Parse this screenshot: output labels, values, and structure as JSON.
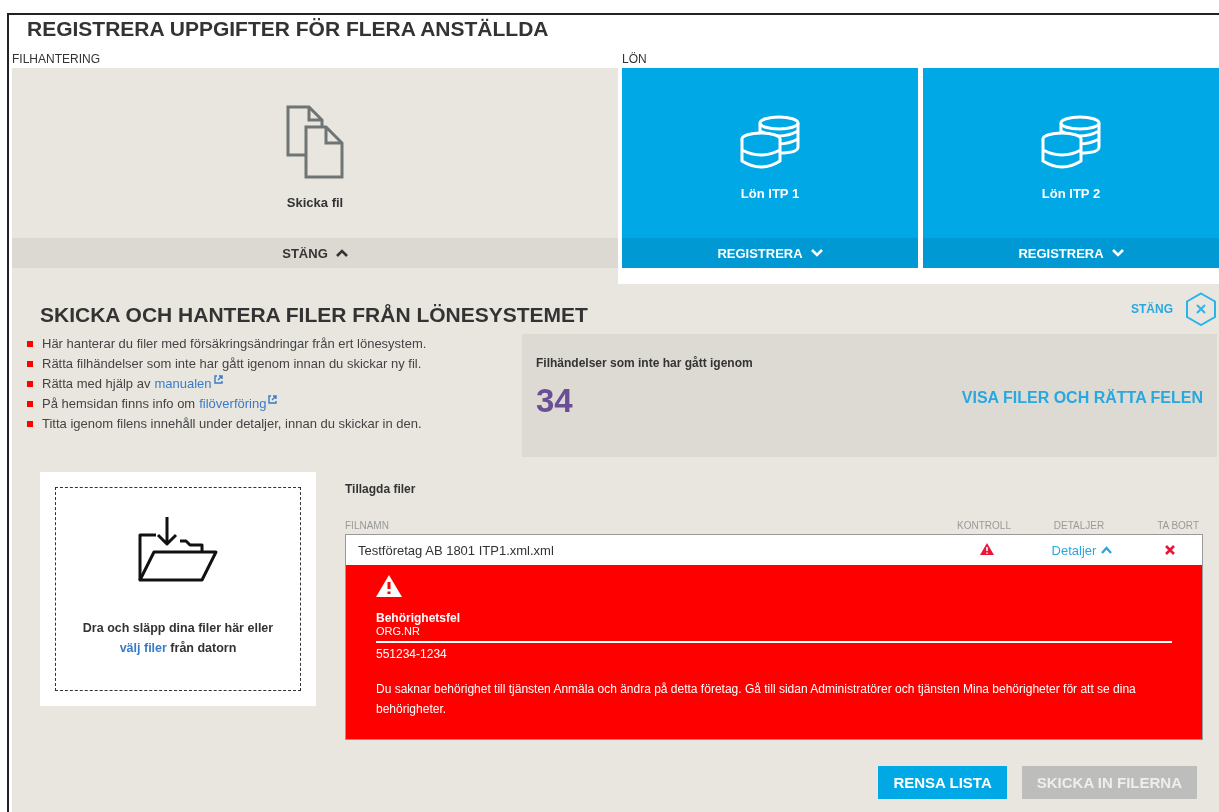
{
  "title": "REGISTRERA UPPGIFTER FÖR FLERA ANSTÄLLDA",
  "sections": [
    {
      "label": "FILHANTERING",
      "tiles": [
        {
          "kind": "file",
          "label": "Skicka fil",
          "action": "STÄNG",
          "expanded": true
        }
      ]
    },
    {
      "label": "LÖN",
      "tiles": [
        {
          "kind": "database",
          "label": "Lön ITP 1",
          "action": "REGISTRERA",
          "expanded": false
        },
        {
          "kind": "database",
          "label": "Lön ITP 2",
          "action": "REGISTRERA",
          "expanded": false
        }
      ]
    }
  ],
  "panel": {
    "heading": "SKICKA OCH HANTERA FILER FRÅN LÖNESYSTEMET",
    "close_label": "STÄNG",
    "bullets": [
      {
        "text": "Här hanterar du filer med försäkringsändringar från ert lönesystem."
      },
      {
        "text": "Rätta filhändelser som inte har gått igenom innan du skickar ny fil."
      },
      {
        "text": "Rätta med hjälp av",
        "link": "manualen"
      },
      {
        "text": "På hemsidan finns info om",
        "link": "filöverföring"
      },
      {
        "text": "Titta igenom filens innehåll under detaljer, innan du skickar in den."
      }
    ],
    "summary": {
      "label": "Filhändelser som inte har gått igenom",
      "count": "34",
      "action": "VISA FILER OCH RÄTTA FELEN"
    },
    "dropzone": {
      "text": "Dra och släpp dina filer här eller",
      "link": "välj filer",
      "text_after": "från datorn"
    },
    "files": {
      "heading": "Tillagda filer",
      "columns": [
        "FILNAMN",
        "KONTROLL",
        "DETALJER",
        "TA BORT"
      ],
      "rows": [
        {
          "name": "Testföretag AB 1801 ITP1.xml.xml",
          "kind": "error",
          "details": "Detaljer",
          "expanded": true,
          "error": {
            "title": "Behörighetsfel",
            "field_label": "ORG.NR",
            "field_value": "551234-1234",
            "message": "Du saknar behörighet till tjänsten Anmäla och ändra på detta företag. Gå till sidan Administratörer och tjänsten Mina behörigheter för att se dina behörigheter."
          }
        }
      ]
    },
    "buttons": [
      {
        "label": "RENSA LISTA",
        "disabled": false
      },
      {
        "label": "SKICKA IN FILERNA",
        "disabled": true
      }
    ]
  }
}
